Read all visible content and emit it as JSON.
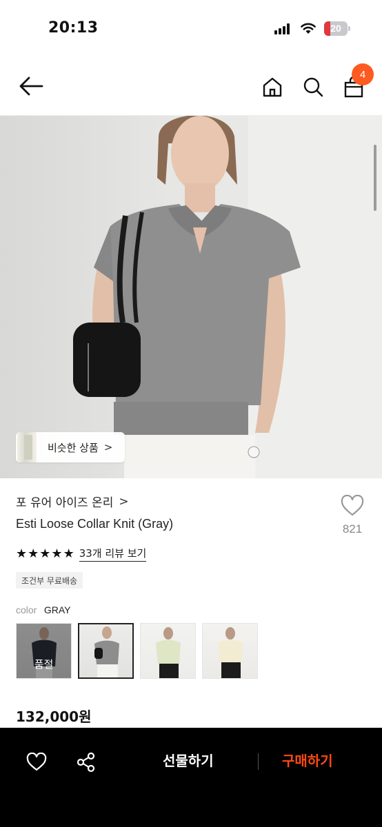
{
  "status_bar": {
    "time": "20:13",
    "battery_level": "20"
  },
  "nav": {
    "icons": [
      "back-arrow-icon",
      "home-icon",
      "search-icon",
      "shopping-bag-icon"
    ],
    "cart_count": "4",
    "accent_color": "#ff5a1f"
  },
  "hero": {
    "similar_products_label": "비슷한 상품"
  },
  "product": {
    "brand": "포 유어 아이즈 온리",
    "name": "Esti Loose Collar Knit (Gray)",
    "like_count": "821",
    "rating": 5,
    "review_link": "33개 리뷰 보기",
    "shipping_tag": "조건부 무료배송",
    "color_label": "color",
    "color_value": "GRAY",
    "swatches": [
      {
        "name": "navy",
        "sold_out_label": "품절"
      },
      {
        "name": "gray",
        "selected": true
      },
      {
        "name": "light-green"
      },
      {
        "name": "cream"
      }
    ],
    "price": "132,000원"
  },
  "bottom_bar": {
    "gift_label": "선물하기",
    "buy_label": "구매하기",
    "buy_color": "#ff4a14"
  }
}
